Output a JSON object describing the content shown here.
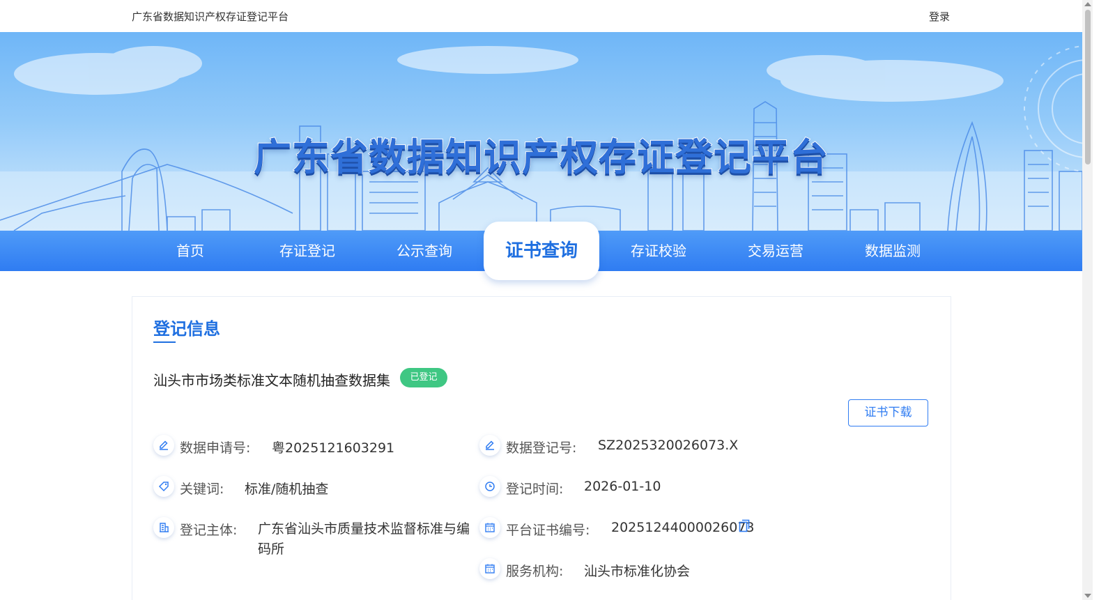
{
  "header": {
    "site_name": "广东省数据知识产权存证登记平台",
    "login_label": "登录"
  },
  "banner": {
    "title": "广东省数据知识产权存证登记平台"
  },
  "nav": {
    "items": [
      {
        "label": "首页"
      },
      {
        "label": "存证登记"
      },
      {
        "label": "公示查询"
      },
      {
        "label": "证书查询"
      },
      {
        "label": "存证校验"
      },
      {
        "label": "交易运营"
      },
      {
        "label": "数据监测"
      }
    ],
    "active": "证书查询"
  },
  "record": {
    "section_title": "登记信息",
    "data_name": "汕头市市场类标准文本随机抽查数据集",
    "status": "已登记",
    "download_label": "证书下载",
    "fields": {
      "application_no": {
        "label": "数据申请号:",
        "value": "粤2025121603291",
        "icon": "edit-icon"
      },
      "registration_no": {
        "label": "数据登记号:",
        "value": "SZ2025320026073.X",
        "icon": "edit-icon"
      },
      "keywords": {
        "label": "关键词:",
        "value": "标准/随机抽查",
        "icon": "tag-icon"
      },
      "registration_time": {
        "label": "登记时间:",
        "value": "2026-01-10",
        "icon": "clock-icon"
      },
      "registrant": {
        "label": "登记主体:",
        "value": "广东省汕头市质量技术监督标准与编码所",
        "icon": "building-icon"
      },
      "certificate_no": {
        "label": "平台证书编号:",
        "value": "20251244000026073",
        "icon": "calendar-icon"
      },
      "service_agency": {
        "label": "服务机构:",
        "value": "汕头市标准化协会",
        "icon": "calendar-icon"
      }
    }
  },
  "colors": {
    "primary": "#2f7cf2",
    "title_blue": "#1f6fe0",
    "badge_green": "#3fc783"
  }
}
